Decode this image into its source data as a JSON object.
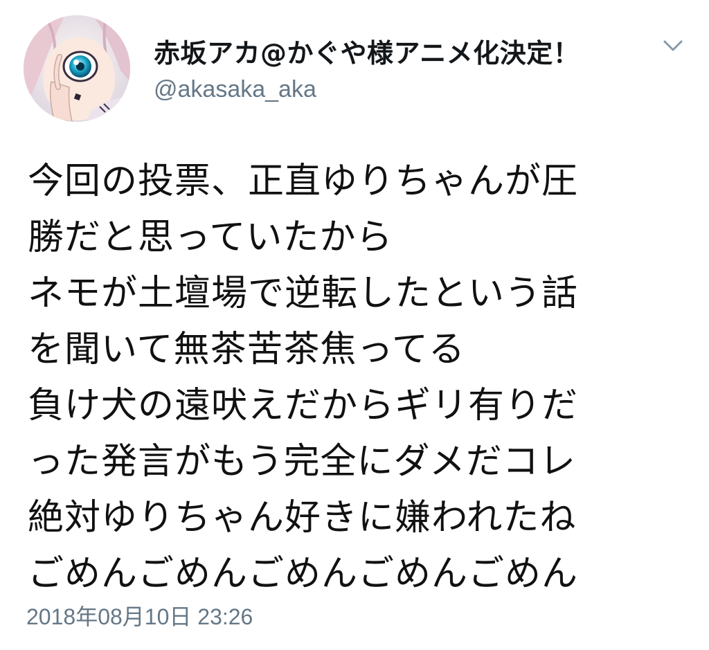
{
  "tweet": {
    "display_name": "赤坂アカ@かぐや様アニメ化決定！",
    "handle": "@akasaka_aka",
    "avatar_icon": "user-avatar-anime-girl",
    "menu_icon": "chevron-down-icon",
    "body_lines": [
      "今回の投票、正直ゆりちゃんが圧",
      "勝だと思っていたから",
      "ネモが土壇場で逆転したという話",
      "を聞いて無茶苦茶焦ってる",
      "負け犬の遠吠えだからギリ有りだ",
      "った発言がもう完全にダメだコレ",
      "絶対ゆりちゃん好きに嫌われたね",
      "ごめんごめんごめんごめんごめん"
    ],
    "timestamp": "2018年08月10日 23:26"
  },
  "colors": {
    "name": "#14171a",
    "secondary": "#657786",
    "body": "#111111",
    "background": "#ffffff"
  }
}
